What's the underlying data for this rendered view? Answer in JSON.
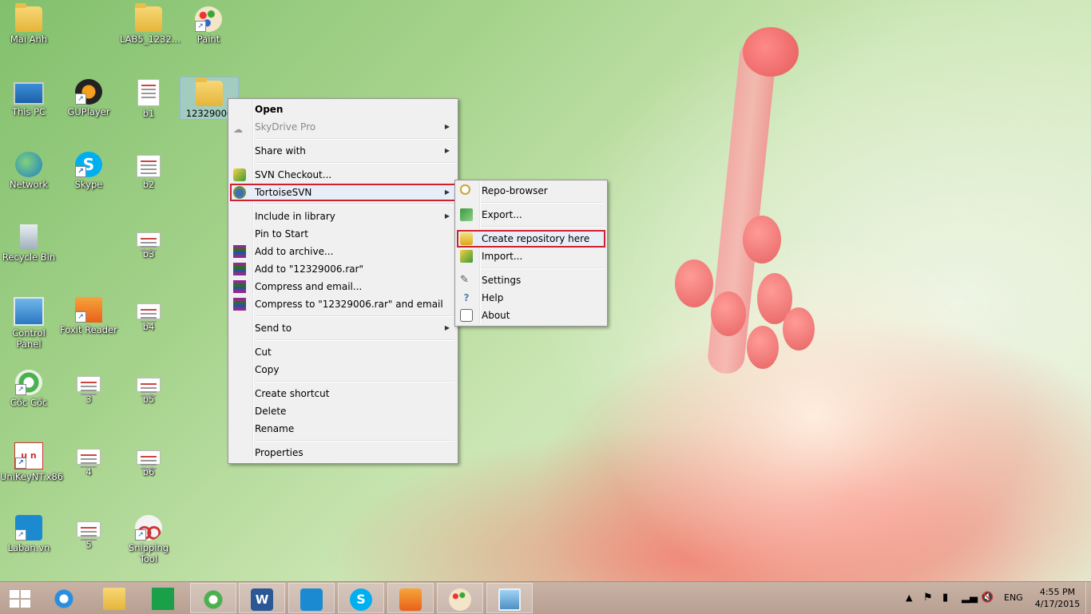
{
  "desktop": {
    "icons": [
      {
        "label": "Mai Anh"
      },
      {
        "label": "LAB5_1232..."
      },
      {
        "label": "Paint"
      },
      {
        "label": "This PC"
      },
      {
        "label": "GUPlayer"
      },
      {
        "label": "b1"
      },
      {
        "label": "12329006"
      },
      {
        "label": "Network"
      },
      {
        "label": "Skype"
      },
      {
        "label": "b2"
      },
      {
        "label": "Recycle Bin"
      },
      {
        "label": "b3"
      },
      {
        "label": "Control Panel"
      },
      {
        "label": "Foxit Reader"
      },
      {
        "label": "b4"
      },
      {
        "label": "Cốc Cốc"
      },
      {
        "label": "3"
      },
      {
        "label": "b5"
      },
      {
        "label": "UniKeyNT.x86"
      },
      {
        "label": "4"
      },
      {
        "label": "b6"
      },
      {
        "label": "Laban.vn"
      },
      {
        "label": "5"
      },
      {
        "label": "Snipping Tool"
      }
    ]
  },
  "context_menu": {
    "open": "Open",
    "skydrive": "SkyDrive Pro",
    "share_with": "Share with",
    "svn_checkout": "SVN Checkout...",
    "tortoisesvn": "TortoiseSVN",
    "include_library": "Include in library",
    "pin_start": "Pin to Start",
    "add_archive": "Add to archive...",
    "add_rar": "Add to \"12329006.rar\"",
    "compress_email": "Compress and email...",
    "compress_rar_email": "Compress to \"12329006.rar\" and email",
    "send_to": "Send to",
    "cut": "Cut",
    "copy": "Copy",
    "create_shortcut": "Create shortcut",
    "delete": "Delete",
    "rename": "Rename",
    "properties": "Properties"
  },
  "svn_submenu": {
    "repo_browser": "Repo-browser",
    "export": "Export...",
    "create_repo": "Create repository here",
    "import": "Import...",
    "settings": "Settings",
    "help": "Help",
    "about": "About"
  },
  "taskbar": {
    "language": "ENG",
    "time": "4:55 PM",
    "date": "4/17/2015"
  },
  "colors": {
    "highlight_border": "#d0202e",
    "taskbar": "#bfa89b"
  }
}
